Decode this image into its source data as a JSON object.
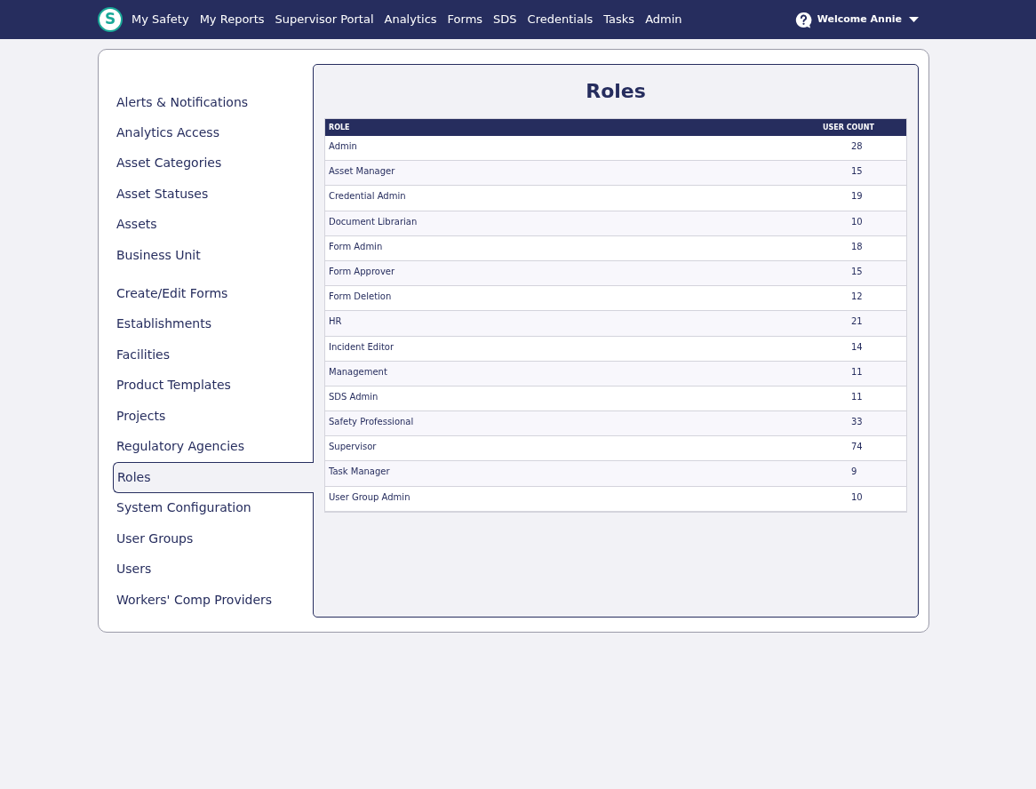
{
  "nav": {
    "logo": "S",
    "items": [
      "My Safety",
      "My Reports",
      "Supervisor Portal",
      "Analytics",
      "Forms",
      "SDS",
      "Credentials",
      "Tasks",
      "Admin"
    ],
    "user": "Welcome Annie"
  },
  "sidebar": {
    "groups": [
      [
        {
          "label": "Alerts & Notifications",
          "selected": false
        },
        {
          "label": "Analytics Access",
          "selected": false
        },
        {
          "label": "Asset Categories",
          "selected": false
        },
        {
          "label": "Asset Statuses",
          "selected": false
        },
        {
          "label": "Assets",
          "selected": false
        },
        {
          "label": "Business Unit",
          "selected": false
        }
      ],
      [
        {
          "label": "Create/Edit Forms",
          "selected": false
        },
        {
          "label": "Establishments",
          "selected": false
        },
        {
          "label": "Facilities",
          "selected": false
        },
        {
          "label": "Product Templates",
          "selected": false
        },
        {
          "label": "Projects",
          "selected": false
        },
        {
          "label": "Regulatory Agencies",
          "selected": false
        },
        {
          "label": "Roles",
          "selected": true
        },
        {
          "label": "System Configuration",
          "selected": false
        },
        {
          "label": "User Groups",
          "selected": false
        },
        {
          "label": "Users",
          "selected": false
        },
        {
          "label": "Workers' Comp Providers",
          "selected": false
        }
      ]
    ]
  },
  "page": {
    "title": "Roles"
  },
  "table": {
    "columns": [
      "ROLE",
      "USER COUNT"
    ],
    "rows": [
      [
        "Admin",
        "28"
      ],
      [
        "Asset Manager",
        "15"
      ],
      [
        "Credential Admin",
        "19"
      ],
      [
        "Document Librarian",
        "10"
      ],
      [
        "Form Admin",
        "18"
      ],
      [
        "Form Approver",
        "15"
      ],
      [
        "Form Deletion",
        "12"
      ],
      [
        "HR",
        "21"
      ],
      [
        "Incident Editor",
        "14"
      ],
      [
        "Management",
        "11"
      ],
      [
        "SDS Admin",
        "11"
      ],
      [
        "Safety Professional",
        "33"
      ],
      [
        "Supervisor",
        "74"
      ],
      [
        "Task Manager",
        "9"
      ],
      [
        "User Group Admin",
        "10"
      ]
    ]
  }
}
